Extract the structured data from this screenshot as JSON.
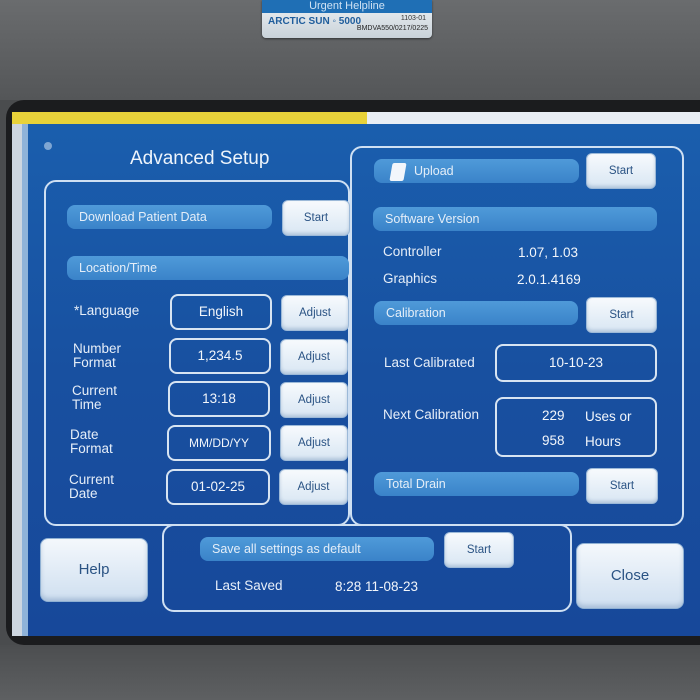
{
  "device": {
    "label_band": "Urgent Helpline",
    "label_brand": "ARCTIC SUN ◦ 5000",
    "label_code1": "1103-01",
    "label_code2": "BMDVA550/0217/0225"
  },
  "screen": {
    "title": "Advanced Setup",
    "download": {
      "label": "Download Patient Data",
      "button": "Start"
    },
    "location_time": {
      "header": "Location/Time",
      "rows": [
        {
          "label_line1": "*Language",
          "label_line2": "",
          "value": "English",
          "button": "Adjust"
        },
        {
          "label_line1": "Number",
          "label_line2": "Format",
          "value": "1,234.5",
          "button": "Adjust"
        },
        {
          "label_line1": "Current",
          "label_line2": "Time",
          "value": "13:18",
          "button": "Adjust"
        },
        {
          "label_line1": "Date",
          "label_line2": "Format",
          "value": "MM/DD/YY",
          "button": "Adjust"
        },
        {
          "label_line1": "Current",
          "label_line2": "Date",
          "value": "01-02-25",
          "button": "Adjust"
        }
      ]
    },
    "upload": {
      "label": "Upload",
      "button": "Start"
    },
    "software_version": {
      "header": "Software Version",
      "controller_label": "Controller",
      "controller_value": "1.07, 1.03",
      "graphics_label": "Graphics",
      "graphics_value": "2.0.1.4169"
    },
    "calibration": {
      "label": "Calibration",
      "button": "Start",
      "last_label": "Last Calibrated",
      "last_value": "10-10-23",
      "next_label": "Next Calibration",
      "next_uses_value": "229",
      "next_uses_unit": "Uses or",
      "next_hours_value": "958",
      "next_hours_unit": "Hours"
    },
    "total_drain": {
      "label": "Total Drain",
      "button": "Start"
    },
    "save": {
      "label": "Save all settings as default",
      "button": "Start",
      "last_saved_label": "Last Saved",
      "last_saved_value": "8:28 11-08-23"
    },
    "help_button": "Help",
    "close_button": "Close"
  },
  "colors": {
    "screen_bg": "#1a5fae",
    "bar": "#3f8bd0",
    "button": "#e8f0f8",
    "text": "#eef4fb"
  }
}
